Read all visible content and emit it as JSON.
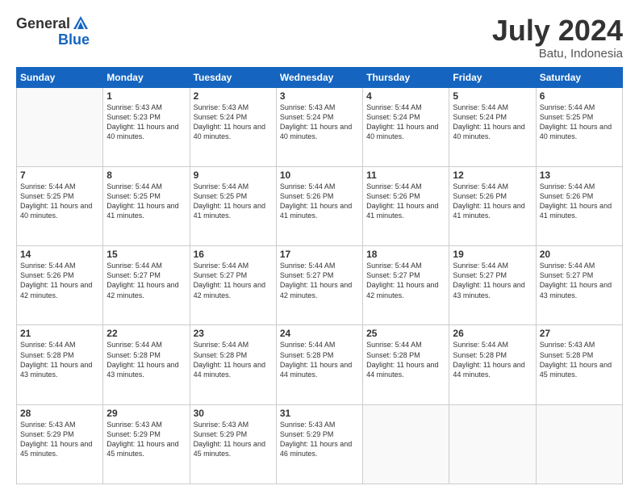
{
  "header": {
    "logo_general": "General",
    "logo_blue": "Blue",
    "month_year": "July 2024",
    "location": "Batu, Indonesia"
  },
  "columns": [
    "Sunday",
    "Monday",
    "Tuesday",
    "Wednesday",
    "Thursday",
    "Friday",
    "Saturday"
  ],
  "weeks": [
    [
      {
        "day": "",
        "sunrise": "",
        "sunset": "",
        "daylight": ""
      },
      {
        "day": "1",
        "sunrise": "Sunrise: 5:43 AM",
        "sunset": "Sunset: 5:23 PM",
        "daylight": "Daylight: 11 hours and 40 minutes."
      },
      {
        "day": "2",
        "sunrise": "Sunrise: 5:43 AM",
        "sunset": "Sunset: 5:24 PM",
        "daylight": "Daylight: 11 hours and 40 minutes."
      },
      {
        "day": "3",
        "sunrise": "Sunrise: 5:43 AM",
        "sunset": "Sunset: 5:24 PM",
        "daylight": "Daylight: 11 hours and 40 minutes."
      },
      {
        "day": "4",
        "sunrise": "Sunrise: 5:44 AM",
        "sunset": "Sunset: 5:24 PM",
        "daylight": "Daylight: 11 hours and 40 minutes."
      },
      {
        "day": "5",
        "sunrise": "Sunrise: 5:44 AM",
        "sunset": "Sunset: 5:24 PM",
        "daylight": "Daylight: 11 hours and 40 minutes."
      },
      {
        "day": "6",
        "sunrise": "Sunrise: 5:44 AM",
        "sunset": "Sunset: 5:25 PM",
        "daylight": "Daylight: 11 hours and 40 minutes."
      }
    ],
    [
      {
        "day": "7",
        "sunrise": "Sunrise: 5:44 AM",
        "sunset": "Sunset: 5:25 PM",
        "daylight": "Daylight: 11 hours and 40 minutes."
      },
      {
        "day": "8",
        "sunrise": "Sunrise: 5:44 AM",
        "sunset": "Sunset: 5:25 PM",
        "daylight": "Daylight: 11 hours and 41 minutes."
      },
      {
        "day": "9",
        "sunrise": "Sunrise: 5:44 AM",
        "sunset": "Sunset: 5:25 PM",
        "daylight": "Daylight: 11 hours and 41 minutes."
      },
      {
        "day": "10",
        "sunrise": "Sunrise: 5:44 AM",
        "sunset": "Sunset: 5:26 PM",
        "daylight": "Daylight: 11 hours and 41 minutes."
      },
      {
        "day": "11",
        "sunrise": "Sunrise: 5:44 AM",
        "sunset": "Sunset: 5:26 PM",
        "daylight": "Daylight: 11 hours and 41 minutes."
      },
      {
        "day": "12",
        "sunrise": "Sunrise: 5:44 AM",
        "sunset": "Sunset: 5:26 PM",
        "daylight": "Daylight: 11 hours and 41 minutes."
      },
      {
        "day": "13",
        "sunrise": "Sunrise: 5:44 AM",
        "sunset": "Sunset: 5:26 PM",
        "daylight": "Daylight: 11 hours and 41 minutes."
      }
    ],
    [
      {
        "day": "14",
        "sunrise": "Sunrise: 5:44 AM",
        "sunset": "Sunset: 5:26 PM",
        "daylight": "Daylight: 11 hours and 42 minutes."
      },
      {
        "day": "15",
        "sunrise": "Sunrise: 5:44 AM",
        "sunset": "Sunset: 5:27 PM",
        "daylight": "Daylight: 11 hours and 42 minutes."
      },
      {
        "day": "16",
        "sunrise": "Sunrise: 5:44 AM",
        "sunset": "Sunset: 5:27 PM",
        "daylight": "Daylight: 11 hours and 42 minutes."
      },
      {
        "day": "17",
        "sunrise": "Sunrise: 5:44 AM",
        "sunset": "Sunset: 5:27 PM",
        "daylight": "Daylight: 11 hours and 42 minutes."
      },
      {
        "day": "18",
        "sunrise": "Sunrise: 5:44 AM",
        "sunset": "Sunset: 5:27 PM",
        "daylight": "Daylight: 11 hours and 42 minutes."
      },
      {
        "day": "19",
        "sunrise": "Sunrise: 5:44 AM",
        "sunset": "Sunset: 5:27 PM",
        "daylight": "Daylight: 11 hours and 43 minutes."
      },
      {
        "day": "20",
        "sunrise": "Sunrise: 5:44 AM",
        "sunset": "Sunset: 5:27 PM",
        "daylight": "Daylight: 11 hours and 43 minutes."
      }
    ],
    [
      {
        "day": "21",
        "sunrise": "Sunrise: 5:44 AM",
        "sunset": "Sunset: 5:28 PM",
        "daylight": "Daylight: 11 hours and 43 minutes."
      },
      {
        "day": "22",
        "sunrise": "Sunrise: 5:44 AM",
        "sunset": "Sunset: 5:28 PM",
        "daylight": "Daylight: 11 hours and 43 minutes."
      },
      {
        "day": "23",
        "sunrise": "Sunrise: 5:44 AM",
        "sunset": "Sunset: 5:28 PM",
        "daylight": "Daylight: 11 hours and 44 minutes."
      },
      {
        "day": "24",
        "sunrise": "Sunrise: 5:44 AM",
        "sunset": "Sunset: 5:28 PM",
        "daylight": "Daylight: 11 hours and 44 minutes."
      },
      {
        "day": "25",
        "sunrise": "Sunrise: 5:44 AM",
        "sunset": "Sunset: 5:28 PM",
        "daylight": "Daylight: 11 hours and 44 minutes."
      },
      {
        "day": "26",
        "sunrise": "Sunrise: 5:44 AM",
        "sunset": "Sunset: 5:28 PM",
        "daylight": "Daylight: 11 hours and 44 minutes."
      },
      {
        "day": "27",
        "sunrise": "Sunrise: 5:43 AM",
        "sunset": "Sunset: 5:28 PM",
        "daylight": "Daylight: 11 hours and 45 minutes."
      }
    ],
    [
      {
        "day": "28",
        "sunrise": "Sunrise: 5:43 AM",
        "sunset": "Sunset: 5:29 PM",
        "daylight": "Daylight: 11 hours and 45 minutes."
      },
      {
        "day": "29",
        "sunrise": "Sunrise: 5:43 AM",
        "sunset": "Sunset: 5:29 PM",
        "daylight": "Daylight: 11 hours and 45 minutes."
      },
      {
        "day": "30",
        "sunrise": "Sunrise: 5:43 AM",
        "sunset": "Sunset: 5:29 PM",
        "daylight": "Daylight: 11 hours and 45 minutes."
      },
      {
        "day": "31",
        "sunrise": "Sunrise: 5:43 AM",
        "sunset": "Sunset: 5:29 PM",
        "daylight": "Daylight: 11 hours and 46 minutes."
      },
      {
        "day": "",
        "sunrise": "",
        "sunset": "",
        "daylight": ""
      },
      {
        "day": "",
        "sunrise": "",
        "sunset": "",
        "daylight": ""
      },
      {
        "day": "",
        "sunrise": "",
        "sunset": "",
        "daylight": ""
      }
    ]
  ]
}
